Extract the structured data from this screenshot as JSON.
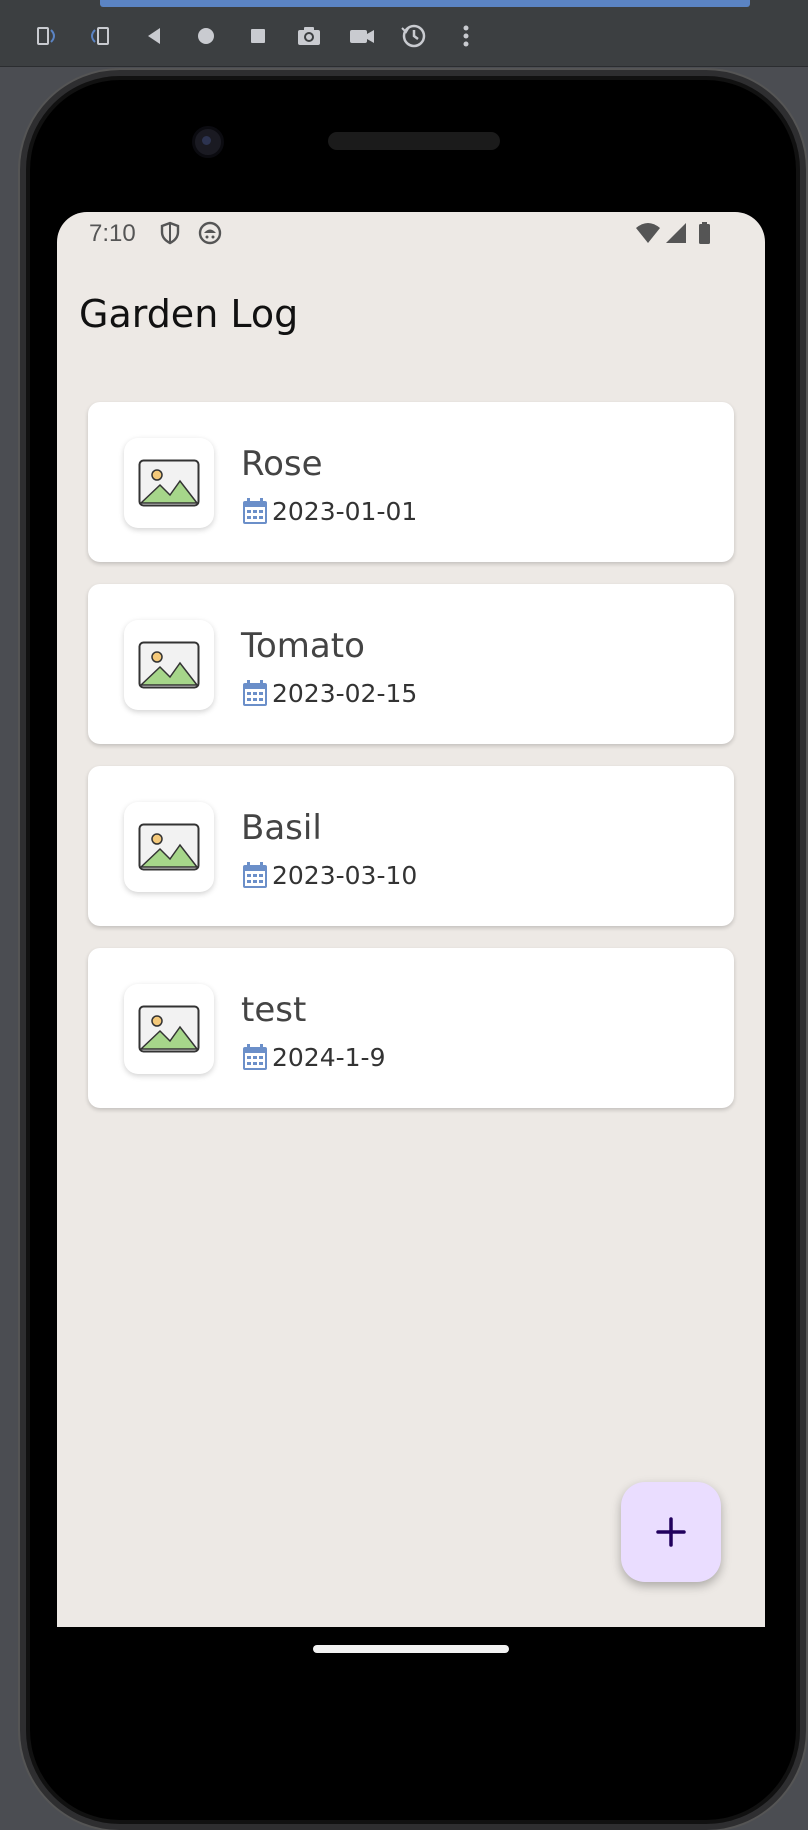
{
  "toolbar": {
    "buttons": [
      {
        "name": "rotate-left-icon"
      },
      {
        "name": "rotate-right-icon"
      },
      {
        "name": "back-icon"
      },
      {
        "name": "home-icon"
      },
      {
        "name": "overview-icon"
      },
      {
        "name": "camera-icon"
      },
      {
        "name": "video-icon"
      },
      {
        "name": "snapshot-icon"
      },
      {
        "name": "more-icon"
      }
    ],
    "colors": {
      "background": "#3c3f41",
      "icon": "#c9cbd0",
      "accent": "#5b84c4"
    }
  },
  "status_bar": {
    "time": "7:10",
    "icons": [
      "shield-icon",
      "android-icon",
      "wifi-icon",
      "signal-icon",
      "battery-icon"
    ]
  },
  "app": {
    "title": "Garden Log",
    "plants": [
      {
        "name": "Rose",
        "date": "2023-01-01"
      },
      {
        "name": "Tomato",
        "date": "2023-02-15"
      },
      {
        "name": "Basil",
        "date": "2023-03-10"
      },
      {
        "name": "test",
        "date": "2024-1-9"
      }
    ],
    "fab_icon": "plus-icon",
    "colors": {
      "background": "#ede9e5",
      "card": "#ffffff",
      "fab": "#eaddff",
      "calendar": "#6b8fc9"
    }
  }
}
